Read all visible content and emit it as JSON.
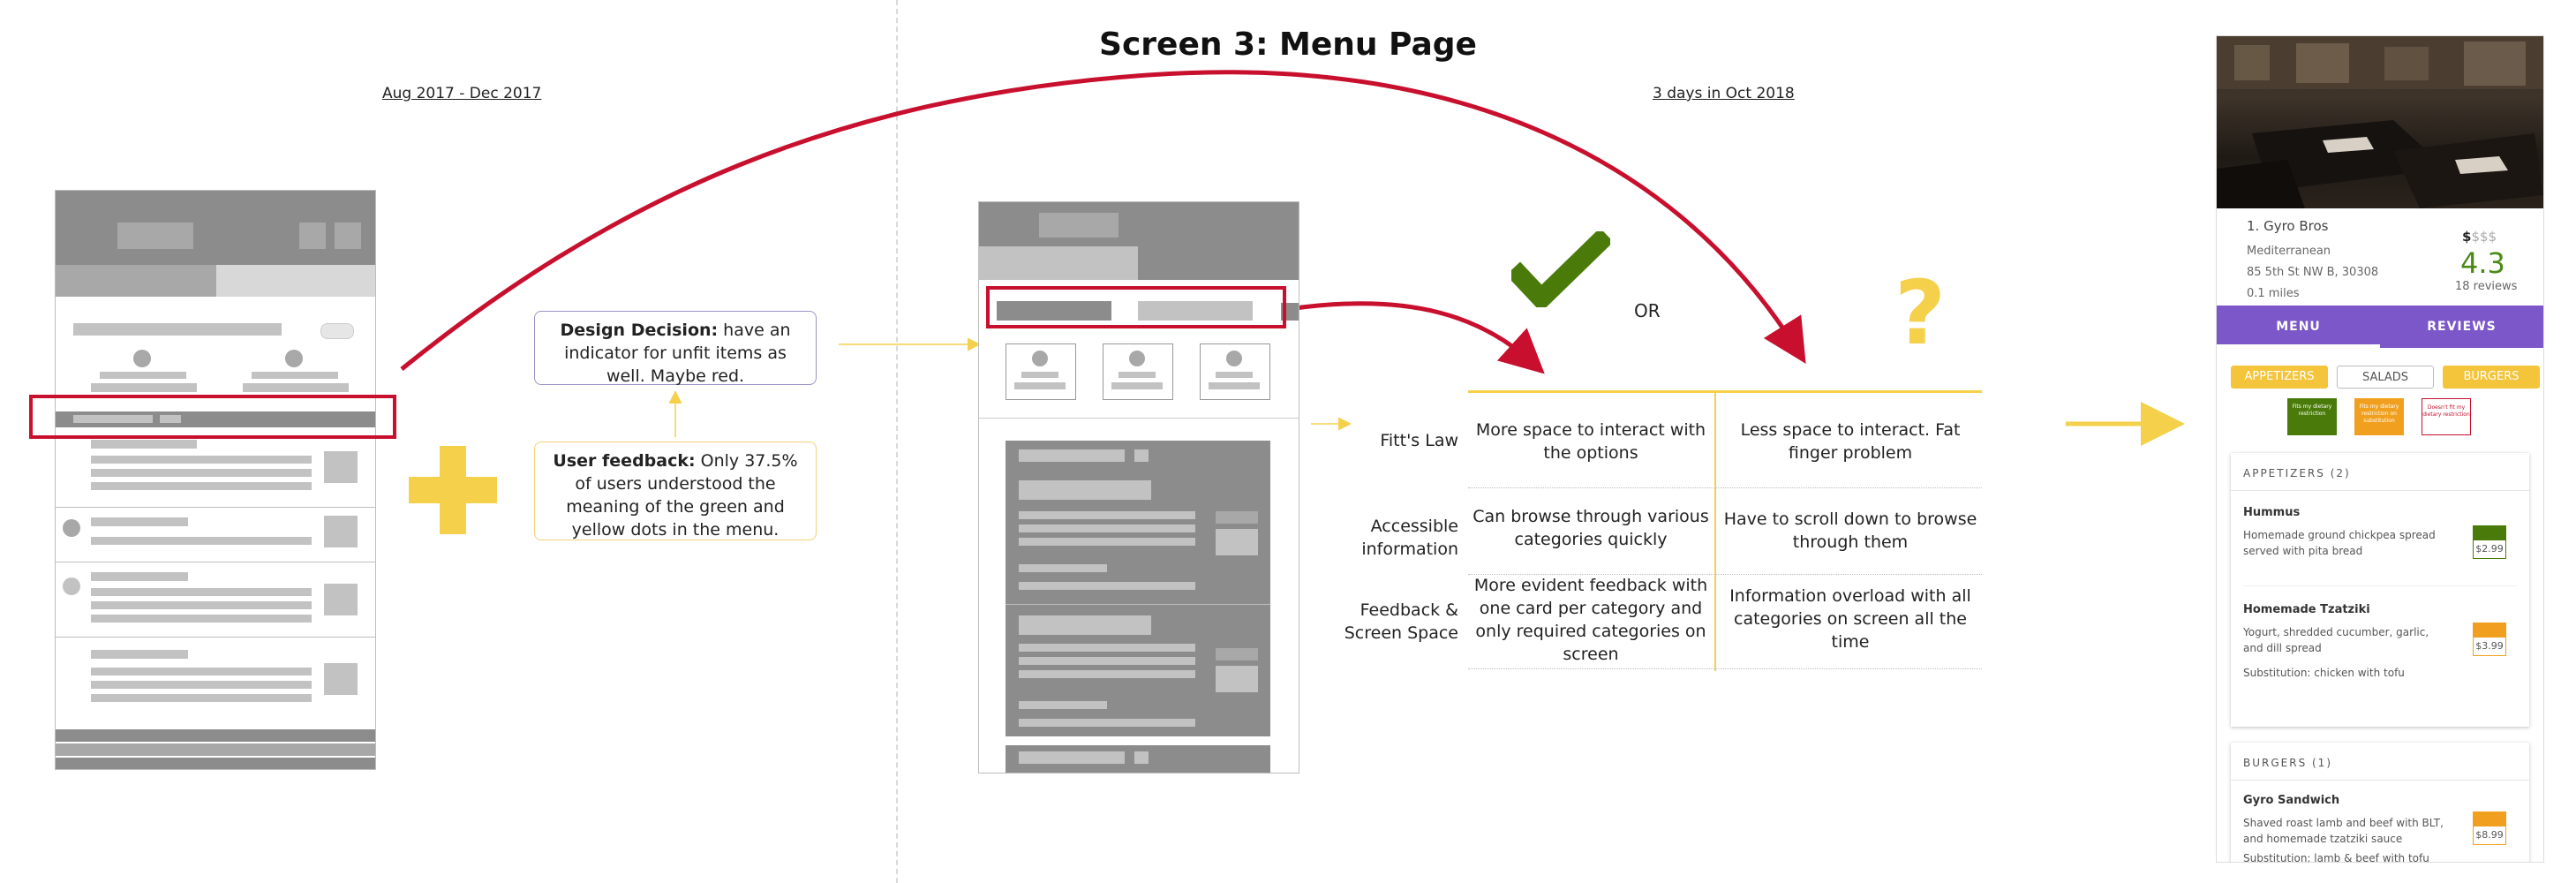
{
  "title": "Screen 3: Menu Page",
  "left_period": "Aug 2017 - Dec 2017",
  "right_period": "3 days in Oct 2018",
  "design_decision": {
    "label": "Design Decision:",
    "text": " have an indicator for unfit items as well. Maybe red."
  },
  "user_feedback": {
    "label": "User feedback:",
    "text": " Only 37.5% of users understood the meaning of the green and yellow dots in the menu."
  },
  "or_label": "OR",
  "question_mark": "?",
  "check_color": "#4a7b0a",
  "accent_red": "#c8102e",
  "accent_yellow": "#f5d04a",
  "comparison": {
    "rows": [
      {
        "label": "Fitt's Law",
        "option_a": "More space to interact with the options",
        "option_b": "Less space to interact. Fat finger problem"
      },
      {
        "label": "Accessible information",
        "option_a": "Can browse through various categories quickly",
        "option_b": "Have to scroll down to browse through them"
      },
      {
        "label": "Feedback & Screen Space",
        "option_a": "More evident feedback with one card per category and only required categories on screen",
        "option_b": "Information overload with all categories on screen all the time"
      }
    ]
  },
  "phone": {
    "restaurant_name": "1. Gyro Bros",
    "cuisine": "Mediterranean",
    "address": "85 5th St NW B, 30308",
    "distance": "0.1 miles",
    "price_level_active": "$",
    "price_level_inactive": "$$$",
    "rating": "4.3",
    "reviews": "18 reviews",
    "tabs": [
      "MENU",
      "REVIEWS"
    ],
    "chips": [
      "APPETIZERS",
      "SALADS",
      "BURGERS"
    ],
    "legend": [
      "Fits my dietary restriction",
      "Fits my dietary restriction on substitution",
      "Doesn't fit my dietary restriction"
    ],
    "sections": [
      {
        "title": "APPETIZERS (2)",
        "items": [
          {
            "name": "Hummus",
            "desc": "Homemade ground chickpea spread served with pita bread",
            "sub": "",
            "price": "$2.99",
            "status": "fit"
          },
          {
            "name": "Homemade Tzatziki",
            "desc": "Yogurt, shredded cucumber, garlic, and dill spread",
            "sub": "Substitution: chicken with tofu",
            "price": "$3.99",
            "status": "substitution"
          }
        ]
      },
      {
        "title": "BURGERS (1)",
        "items": [
          {
            "name": "Gyro Sandwich",
            "desc": "Shaved roast lamb and beef with BLT, and homemade tzatziki sauce",
            "sub": "Substitution: lamb & beef with tofu",
            "price": "$8.99",
            "status": "substitution"
          }
        ]
      }
    ]
  }
}
